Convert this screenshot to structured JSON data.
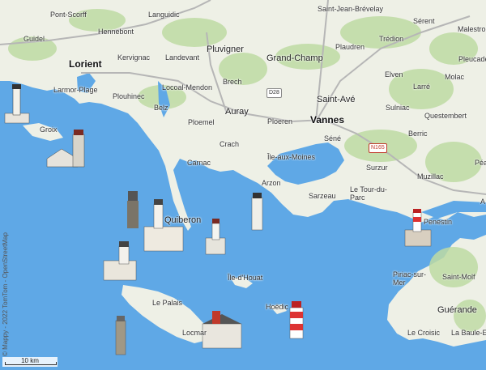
{
  "map": {
    "attribution": "© Mappy - 2022 TomTom - OpenStreetMap",
    "scale_label": "10 km",
    "colors": {
      "sea": "#5fa8e6",
      "land": "#eef0e6",
      "green": "#bfdba4",
      "roads": "#b6b6b6"
    }
  },
  "places": {
    "pont_scorff": "Pont-Scorff",
    "languidic": "Languidic",
    "saint_jean": "Saint-Jean-Brévelay",
    "serent": "Sérent",
    "malestroit": "Malestroit",
    "guidel": "Guidel",
    "hennebont": "Hennebont",
    "trédion": "Trédion",
    "lorient": "Lorient",
    "kervignac": "Kervignac",
    "landevant": "Landevant",
    "pluvigner": "Pluvigner",
    "grand_champ": "Grand-Champ",
    "plaudren": "Plaudren",
    "pleucadec": "Pleucade",
    "larmor": "Larmor-Plage",
    "locoal": "Locoal-Mendon",
    "brech": "Brech",
    "elven": "Elven",
    "molac": "Molac",
    "plouhinec": "Plouhinec",
    "belz": "Belz",
    "auray": "Auray",
    "saint_ave": "Saint-Avé",
    "larre": "Larré",
    "sulniac": "Sulniac",
    "questembert": "Questembert",
    "groix": "Groix",
    "ploemel": "Ploemel",
    "ploeren": "Ploeren",
    "vannes": "Vannes",
    "berric": "Berric",
    "sene": "Séné",
    "crach": "Crach",
    "ile_moines": "Île-aux-Moines",
    "carnac": "Carnac",
    "surzur": "Surzur",
    "muzillac": "Muzillac",
    "pea": "Péa",
    "arzon": "Arzon",
    "sarzeau": "Sarzeau",
    "tour_du_parc": "Le Tour-du-Parc",
    "quiberon": "Quiberon",
    "penestin": "Penestin",
    "a_edge": "A",
    "houat": "Île-d'Houat",
    "piriac": "Piriac-sur-Mer",
    "saint_molf": "Saint-Molf",
    "le_palais": "Le Palais",
    "hoedic": "Hoëdic",
    "locmaria": "Locmar",
    "guerande": "Guérande",
    "le_croisic": "Le Croisic",
    "la_baule": "La Baule-Es"
  },
  "roads": {
    "d28": "D28",
    "n165": "N165"
  }
}
